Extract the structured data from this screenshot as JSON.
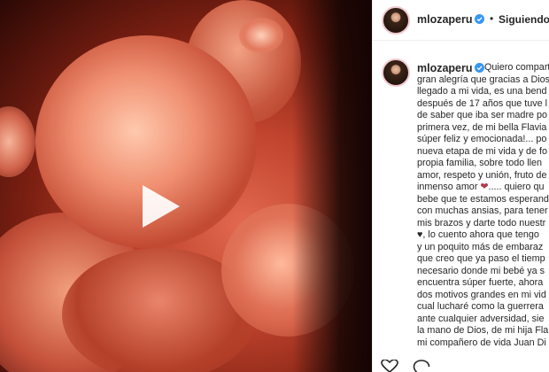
{
  "header": {
    "username": "mlozaperu",
    "separator": "•",
    "follow_label": "Siguiendo"
  },
  "comment": {
    "username": "mlozaperu",
    "lines": [
      "Quiero compart",
      "gran alegría que gracias a Dios",
      "llegado a mi vida, es una bend",
      "después de 17 años que tuve l",
      "de saber que iba ser madre po",
      "primera vez, de mi bella Flavia",
      "súper feliz y emocionada!... po",
      "nueva etapa de mi vida y de fo",
      "propia familia, sobre todo llen",
      "amor, respeto y unión, fruto de",
      "inmenso amor",
      "..... quiero qu",
      "bebe que te estamos esperand",
      "con muchas ansias, para tener",
      "mis brazos y darte todo nuestr",
      ", lo cuento ahora que tengo",
      "y un poquito más de embaraz",
      "que creo que ya paso el tiemp",
      "necesario donde mi bebé ya s",
      "encuentra súper fuerte, ahora",
      "dos motivos grandes en mi vid",
      "cual lucharé como la guerrera",
      "ante cualquier adversidad, sie",
      "la mano de Dios, de mi hija Fla",
      "mi compañero de vida Juan Di"
    ],
    "emoji_heart": "❤",
    "emoji_black_heart": "♥"
  },
  "icons": {
    "play": "play-icon",
    "verified": "verified-badge-icon",
    "like": "heart-outline-icon",
    "comment": "comment-icon"
  },
  "colors": {
    "verified_blue": "#3897f0",
    "text": "#262626"
  }
}
